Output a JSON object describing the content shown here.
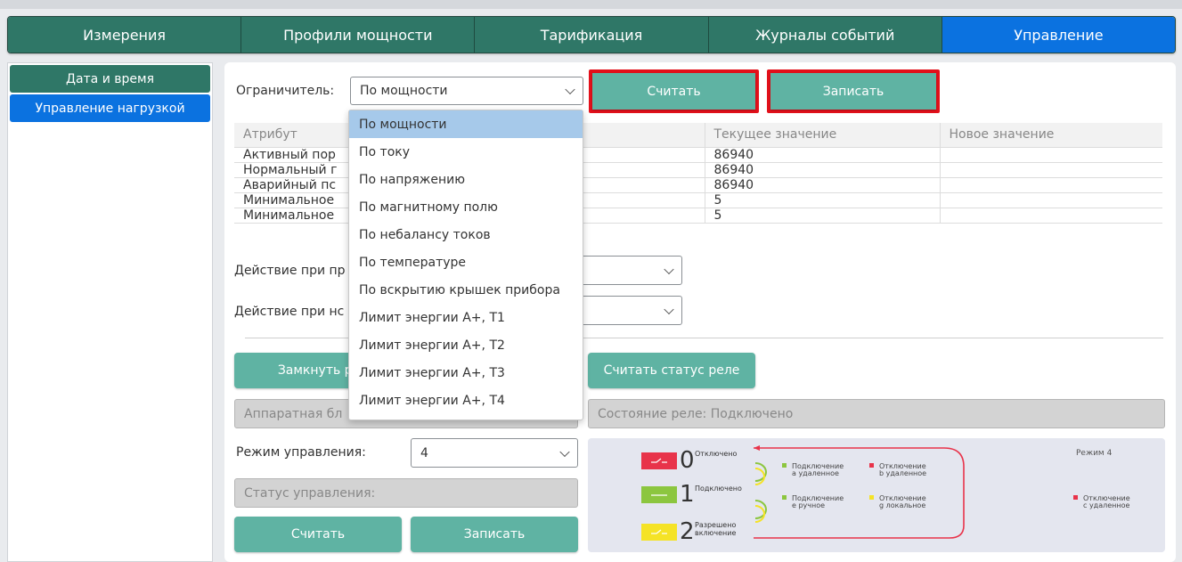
{
  "nav": {
    "tabs": [
      {
        "label": "Измерения"
      },
      {
        "label": "Профили мощности"
      },
      {
        "label": "Тарификация"
      },
      {
        "label": "Журналы событий"
      },
      {
        "label": "Управление"
      }
    ],
    "active": "Управление",
    "colors": {
      "tab": "#2f7767",
      "active": "#0b72e0"
    }
  },
  "sidebar": {
    "items": [
      {
        "label": "Дата и время"
      },
      {
        "label": "Управление нагрузкой"
      }
    ]
  },
  "limiter": {
    "label": "Ограничитель:",
    "selected": "По мощности",
    "read_label": "Считать",
    "write_label": "Записать"
  },
  "dropdown": {
    "options": [
      "По мощности",
      "По току",
      "По напряжению",
      "По магнитному полю",
      "По небалансу токов",
      "По температуре",
      "По вскрытию крышек прибора",
      "Лимит энергии A+, T1",
      "Лимит энергии A+, T2",
      "Лимит энергии A+, T3",
      "Лимит энергии A+, T4"
    ]
  },
  "table": {
    "headers": [
      "Атрибут",
      "Текущее значение",
      "Новое значение"
    ],
    "rows": [
      {
        "attr": "Активный пор",
        "current": "86940",
        "new": ""
      },
      {
        "attr": "Нормальный г",
        "current": "86940",
        "new": ""
      },
      {
        "attr": "Аварийный пс",
        "current": "86940",
        "new": ""
      },
      {
        "attr": "Минимальное",
        "current": "5",
        "new": ""
      },
      {
        "attr": "Минимальное",
        "current": "5",
        "new": ""
      }
    ]
  },
  "actions": {
    "action1_label": "Действие при пр",
    "action2_label": "Действие при нс"
  },
  "relay": {
    "close_label": "Замкнуть ре",
    "read_status_label": "Считать статус реле",
    "hw_block": "Аппаратная бл",
    "relay_state": "Состояние реле: Подключено"
  },
  "control": {
    "mode_label": "Режим управления:",
    "mode_value": "4",
    "status_placeholder": "Статус управления:",
    "read_label": "Считать",
    "write_label": "Записать"
  },
  "diagram": {
    "title": "Режим 4",
    "states": [
      {
        "num": "0",
        "text": "Отключено",
        "color": "#e8334a"
      },
      {
        "num": "1",
        "text": "Подключено",
        "color": "#8cc63f"
      },
      {
        "num": "2",
        "text": "Разрешено\nвключение",
        "color": "#f5e326"
      }
    ],
    "legend": [
      {
        "line1": "Подключение",
        "line2": "a удаленное",
        "color": "#8cc63f"
      },
      {
        "line1": "Отключение",
        "line2": "b удаленное",
        "color": "#e8334a"
      },
      {
        "line1": "Подключение",
        "line2": "e ручное",
        "color": "#8cc63f"
      },
      {
        "line1": "Отключение",
        "line2": "g локальное",
        "color": "#f5e326"
      },
      {
        "line1": "Отключение",
        "line2": "c удаленное",
        "color": "#e8334a"
      }
    ]
  }
}
